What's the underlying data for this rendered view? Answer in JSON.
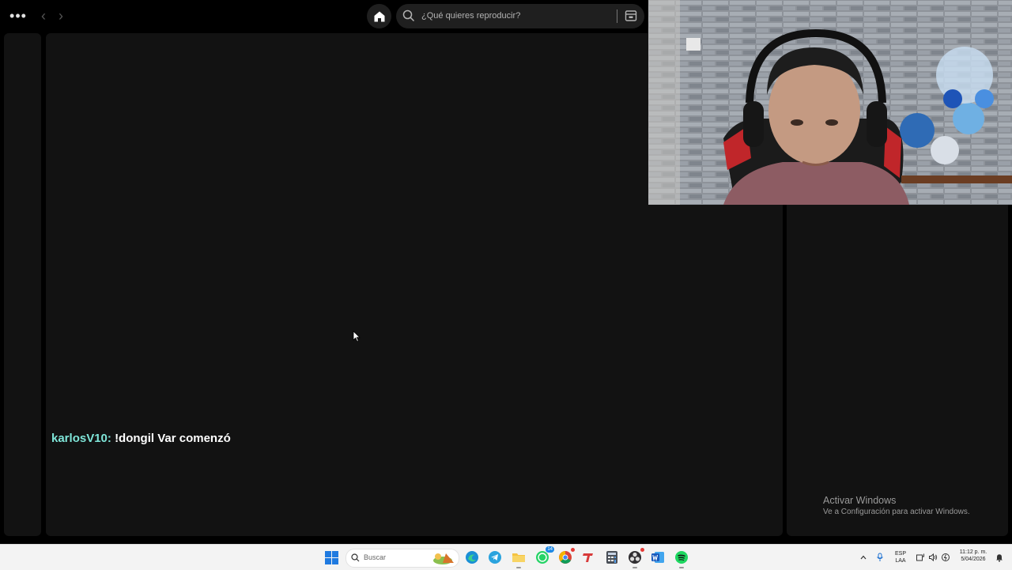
{
  "topbar": {
    "more_label": "•••",
    "search_placeholder": "¿Qué quieres reproducir?"
  },
  "chat": {
    "user": "karlosV10:",
    "message": "!dongil Var comenzó"
  },
  "watermark": {
    "title": "Activar Windows",
    "subtitle": "Ve a Configuración para activar Windows."
  },
  "taskbar": {
    "search_placeholder": "Buscar",
    "whatsapp_badge": "14",
    "lang_line1": "ESP",
    "lang_line2": "LAA",
    "time": "11:12 p. m.",
    "date": "5/04/2026"
  }
}
